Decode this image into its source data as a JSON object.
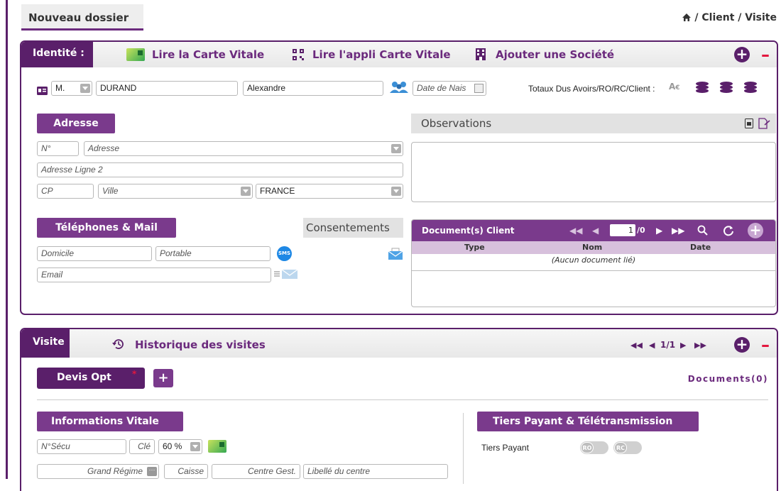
{
  "header": {
    "tab_label": "Nouveau dossier",
    "breadcrumb": "/ Client / Visite"
  },
  "identite": {
    "tab_label": "Identité :",
    "lire_carte": "Lire la Carte Vitale",
    "lire_appli": "Lire l'appli Carte Vitale",
    "ajouter_societe": "Ajouter une Société",
    "civilite": "M.",
    "nom": "DURAND",
    "prenom": "Alexandre",
    "date_placeholder": "Date de Nais",
    "totaux_label": "Totaux Dus Avoirs/RO/RC/Client :"
  },
  "adresse": {
    "title": "Adresse",
    "num_placeholder": "N°",
    "adresse_placeholder": "Adresse",
    "ligne2_placeholder": "Adresse Ligne 2",
    "cp_placeholder": "CP",
    "ville_placeholder": "Ville",
    "pays": "FRANCE"
  },
  "observations": {
    "title": "Observations"
  },
  "telephones": {
    "title": "Téléphones & Mail",
    "consentements": "Consentements",
    "domicile_placeholder": "Domicile",
    "portable_placeholder": "Portable",
    "email_placeholder": "Email",
    "sms_label": "SMS"
  },
  "documents": {
    "title": "Document(s) Client",
    "page_value": "1",
    "page_total": "/0",
    "columns": [
      "Type",
      "Nom",
      "Date"
    ],
    "empty": "(Aucun document lié)"
  },
  "visite": {
    "tab_label": "Visite",
    "historique": "Historique des visites",
    "pagination": "1/1",
    "devis_label": "Devis Opt",
    "documents_count": "Documents(0)"
  },
  "vitale": {
    "title": "Informations Vitale",
    "nsecu_placeholder": "N°Sécu",
    "cle_placeholder": "Clé",
    "taux": "60 %",
    "grand_regime_placeholder": "Grand Régime",
    "caisse_placeholder": "Caisse",
    "centre_placeholder": "Centre Gest.",
    "libelle_placeholder": "Libellé du centre"
  },
  "tiers": {
    "title": "Tiers Payant & Télétransmission",
    "tiers_payant_label": "Tiers Payant",
    "ro": "RO",
    "rc": "RC"
  },
  "colors": {
    "primary": "#5a1f6a",
    "accent": "#7a3a8c",
    "danger": "#e3173e"
  }
}
